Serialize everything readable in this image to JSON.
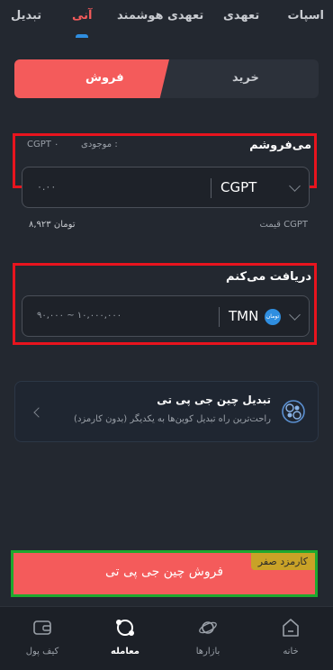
{
  "tabs": [
    "اسپات",
    "تعهدی",
    "تعهدی هوشمند",
    "آنی",
    "تبدیل"
  ],
  "toggle": {
    "buy": "خرید",
    "sell": "فروش"
  },
  "sell_section": {
    "title": "می‌فروشم",
    "balance_label": "موجودی :",
    "balance_value": "CGPT ۰",
    "amount_placeholder": "۰.۰۰",
    "currency": "CGPT"
  },
  "price_row": {
    "label": "قیمت CGPT",
    "value": "۸,۹۲۳ تومان"
  },
  "receive_section": {
    "title": "دریافت می‌کنم",
    "amount_placeholder": "۹۰,۰۰۰ ~ ۱۰,۰۰۰,۰۰۰",
    "currency": "TMN",
    "currency_badge": "تومان"
  },
  "convert_card": {
    "title": "تبدیل چین جی پی تی",
    "subtitle": "راحت‌ترین راه تبدیل کوین‌ها به یکدیگر (بدون کارمزد)"
  },
  "main_button": {
    "label": "فروش چین جی پی تی",
    "badge": "کارمزد صفر"
  },
  "bottom_nav": [
    "خانه",
    "بازارها",
    "معامله",
    "کیف پول"
  ],
  "colors": {
    "accent_red": "#f45b5b",
    "tab_indicator": "#2f8ee0",
    "badge_gold": "#c9a227"
  }
}
